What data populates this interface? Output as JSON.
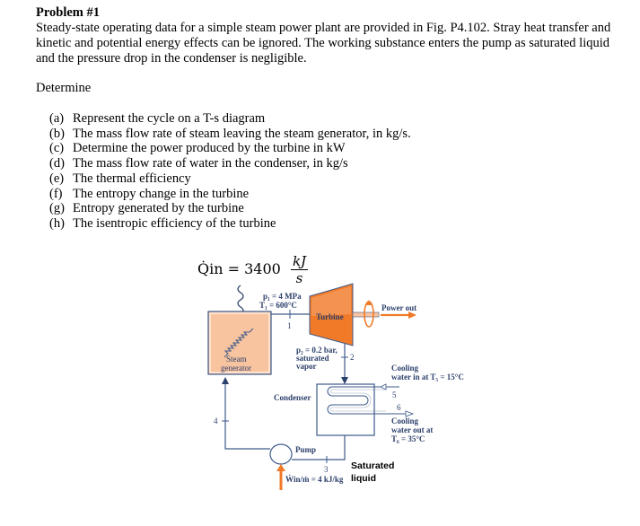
{
  "problem": {
    "title": "Problem #1",
    "intro": "Steady-state operating data for a simple steam power plant are provided in Fig. P4.102. Stray heat transfer and kinetic and potential energy effects can be ignored.  The working substance enters the pump as saturated liquid and the pressure drop in the condenser is negligible.",
    "determine": "Determine",
    "questions": [
      {
        "label": "(a)",
        "text": "Represent the cycle on a T-s diagram"
      },
      {
        "label": "(b)",
        "text": "The mass flow rate of steam leaving the steam generator, in kg/s."
      },
      {
        "label": "(c)",
        "text": "Determine the power produced by the turbine in kW"
      },
      {
        "label": "(d)",
        "text": "The mass flow rate of water in the condenser, in kg/s"
      },
      {
        "label": "(e)",
        "text": "The thermal efficiency"
      },
      {
        "label": "(f)",
        "text": "The entropy change in the turbine"
      },
      {
        "label": "(g)",
        "text": "Entropy generated by the turbine"
      },
      {
        "label": "(h)",
        "text": "The isentropic efficiency of the turbine"
      }
    ]
  },
  "figure": {
    "qin": {
      "symbol": "Q̇in = 3400",
      "unit_num": "kJ",
      "unit_den": "s"
    },
    "state1": {
      "p": "p₁ = 4 MPa",
      "T": "T₁ = 600°C",
      "num": "1"
    },
    "state2": {
      "line1": "p₂ = 0.2 bar,",
      "line2": "saturated",
      "line3": "vapor",
      "num": "2"
    },
    "state3": {
      "num": "3"
    },
    "state4": {
      "num": "4"
    },
    "state5": {
      "line1": "Cooling",
      "line2": "water in at T₅ = 15°C",
      "num": "5"
    },
    "state6": {
      "num": "6",
      "line1": "Cooling",
      "line2": "water out at",
      "line3": "T₆ = 35°C"
    },
    "turbine_label": "Turbine",
    "power_out_label": "Power out",
    "steam_gen_line1": "Steam",
    "steam_gen_line2": "generator",
    "condenser_label": "Condenser",
    "pump_label": "Pump",
    "pump_work": "Ẇin/ṁ = 4 kJ/kg",
    "saturated_liquid_line1": "Saturated",
    "saturated_liquid_line2": "liquid",
    "colors": {
      "line": "#3d5a8a",
      "orange": "#f07a28",
      "steam_gen_fill": "#f8c4a0",
      "label": "#2b3f6b"
    }
  }
}
